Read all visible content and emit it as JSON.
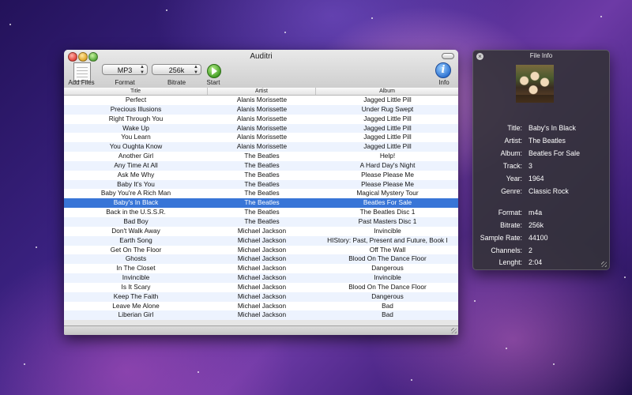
{
  "window": {
    "title": "Auditri"
  },
  "toolbar": {
    "add_files_label": "Add Files",
    "format_label": "Format",
    "format_value": "MP3",
    "bitrate_label": "Bitrate",
    "bitrate_value": "256k",
    "start_label": "Start",
    "info_label": "Info",
    "info_glyph": "i"
  },
  "table": {
    "columns": [
      "Title",
      "Artist",
      "Album"
    ],
    "selected_index": 11,
    "rows": [
      [
        "Perfect",
        "Alanis Morissette",
        "Jagged Little Pill"
      ],
      [
        "Precious Illusions",
        "Alanis Morissette",
        "Under Rug Swept"
      ],
      [
        "Right Through You",
        "Alanis Morissette",
        "Jagged Little Pill"
      ],
      [
        "Wake Up",
        "Alanis Morissette",
        "Jagged Little Pill"
      ],
      [
        "You Learn",
        "Alanis Morissette",
        "Jagged Little Pill"
      ],
      [
        "You Oughta Know",
        "Alanis Morissette",
        "Jagged Little Pill"
      ],
      [
        "Another Girl",
        "The Beatles",
        "Help!"
      ],
      [
        "Any Time At All",
        "The Beatles",
        "A Hard Day's Night"
      ],
      [
        "Ask Me Why",
        "The Beatles",
        "Please Please Me"
      ],
      [
        "Baby It's You",
        "The Beatles",
        "Please Please Me"
      ],
      [
        "Baby You're A Rich Man",
        "The Beatles",
        "Magical Mystery Tour"
      ],
      [
        "Baby's In Black",
        "The Beatles",
        "Beatles For Sale"
      ],
      [
        "Back in the U.S.S.R.",
        "The Beatles",
        "The Beatles Disc 1"
      ],
      [
        "Bad Boy",
        "The Beatles",
        "Past Masters Disc 1"
      ],
      [
        "Don't Walk Away",
        "Michael Jackson",
        "Invincible"
      ],
      [
        "Earth Song",
        "Michael Jackson",
        "HIStory: Past, Present and Future, Book I"
      ],
      [
        "Get On The Floor",
        "Michael Jackson",
        "Off The Wall"
      ],
      [
        "Ghosts",
        "Michael Jackson",
        "Blood On The Dance Floor"
      ],
      [
        "In The Closet",
        "Michael Jackson",
        "Dangerous"
      ],
      [
        "Invincible",
        "Michael Jackson",
        "Invincible"
      ],
      [
        "Is It Scary",
        "Michael Jackson",
        "Blood On The Dance Floor"
      ],
      [
        "Keep The Faith",
        "Michael Jackson",
        "Dangerous"
      ],
      [
        "Leave Me Alone",
        "Michael Jackson",
        "Bad"
      ],
      [
        "Liberian Girl",
        "Michael Jackson",
        "Bad"
      ]
    ]
  },
  "file_info": {
    "title": "File Info",
    "close_glyph": "×",
    "fields": [
      {
        "key": "Title:",
        "value": "Baby's In Black"
      },
      {
        "key": "Artist:",
        "value": "The Beatles"
      },
      {
        "key": "Album:",
        "value": "Beatles For Sale"
      },
      {
        "key": "Track:",
        "value": "3"
      },
      {
        "key": "Year:",
        "value": "1964"
      },
      {
        "key": "Genre:",
        "value": "Classic Rock"
      },
      {
        "key": "Format:",
        "value": "m4a"
      },
      {
        "key": "Bitrate:",
        "value": "256k"
      },
      {
        "key": "Sample Rate:",
        "value": "44100"
      },
      {
        "key": "Channels:",
        "value": "2"
      },
      {
        "key": "Lenght:",
        "value": "2:04"
      }
    ]
  }
}
